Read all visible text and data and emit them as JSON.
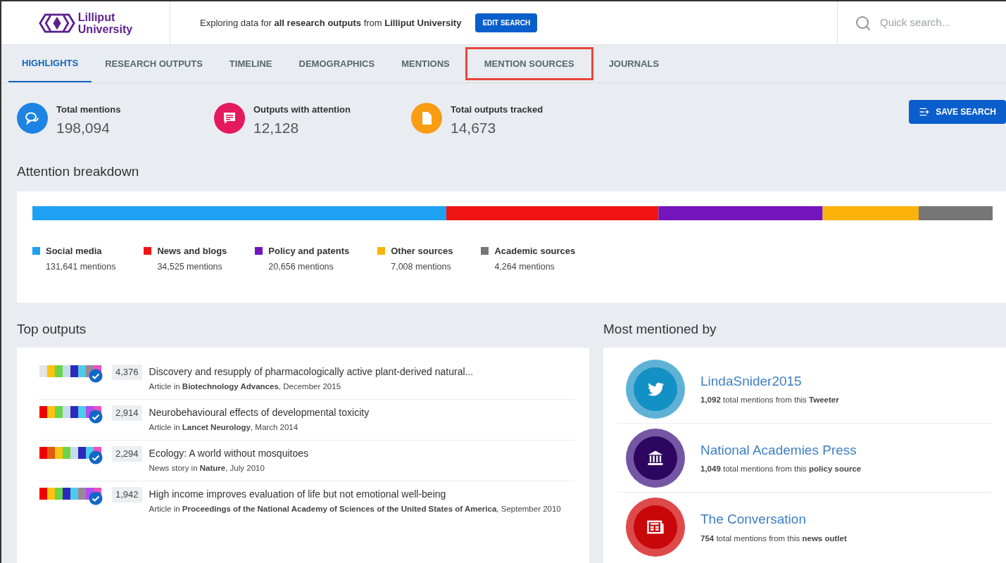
{
  "header": {
    "logo": {
      "line1": "Lilliput",
      "line2": "University"
    },
    "context": "Exploring data for **all research outputs** from **Lilliput University**",
    "edit_button": "EDIT SEARCH",
    "search": {
      "placeholder": "Quick search..."
    }
  },
  "tabs": [
    {
      "label": "HIGHLIGHTS",
      "selected": true,
      "highlighted": false
    },
    {
      "label": "RESEARCH OUTPUTS",
      "selected": false,
      "highlighted": false
    },
    {
      "label": "TIMELINE",
      "selected": false,
      "highlighted": false
    },
    {
      "label": "DEMOGRAPHICS",
      "selected": false,
      "highlighted": false
    },
    {
      "label": "MENTIONS",
      "selected": false,
      "highlighted": false
    },
    {
      "label": "MENTION SOURCES",
      "selected": false,
      "highlighted": true
    },
    {
      "label": "JOURNALS",
      "selected": false,
      "highlighted": false
    }
  ],
  "stats": [
    {
      "kind": "mentions",
      "label": "Total mentions",
      "value": "198,094"
    },
    {
      "kind": "attention",
      "label": "Outputs with attention",
      "value": "12,128"
    },
    {
      "kind": "tracked",
      "label": "Total outputs tracked",
      "value": "14,673"
    }
  ],
  "save_button": "SAVE SEARCH",
  "breakdown": {
    "title": "Attention breakdown",
    "segments": [
      {
        "name": "Social media",
        "color": "#1ea1f2",
        "count": "131,641 mentions"
      },
      {
        "name": "News and blogs",
        "color": "#f01414",
        "count": "34,525 mentions"
      },
      {
        "name": "Policy and patents",
        "color": "#7414bd",
        "count": "20,656 mentions"
      },
      {
        "name": "Other sources",
        "color": "#fbb309",
        "count": "7,008 mentions"
      },
      {
        "name": "Academic sources",
        "color": "#767676",
        "count": "4,264 mentions"
      }
    ]
  },
  "top_outputs": {
    "title": "Top outputs",
    "items": [
      {
        "score": "4,376",
        "title": "Discovery and resupply of pharmacologically active plant-derived natural...",
        "meta": "Article in **Biotechnology Advances**, December 2015"
      },
      {
        "score": "2,914",
        "title": "Neurobehavioural effects of developmental toxicity",
        "meta": "Article in **Lancet Neurology**, March 2014"
      },
      {
        "score": "2,294",
        "title": "Ecology: A world without mosquitoes",
        "meta": "News story in **Nature**, July 2010"
      },
      {
        "score": "1,942",
        "title": "High income improves evaluation of life but not emotional well-being",
        "meta": "Article in **Proceedings of the National Academy of Sciences of the United States of America**, September 2010"
      }
    ]
  },
  "most_mentioned": {
    "title": "Most mentioned by",
    "items": [
      {
        "kind": "twitter",
        "name": "LindaSnider2015",
        "summary": "**1,092** total mentions from this **Tweeter**"
      },
      {
        "kind": "policy",
        "name": "National Academies Press",
        "summary": "**1,049** total mentions from this **policy source**"
      },
      {
        "kind": "news",
        "name": "The Conversation",
        "summary": "**754** total mentions from this **news outlet**"
      }
    ]
  }
}
